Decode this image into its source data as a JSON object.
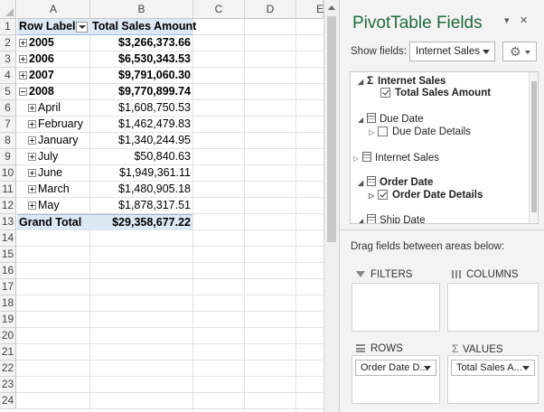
{
  "sheet": {
    "columns": [
      "A",
      "B",
      "C",
      "D",
      "E"
    ],
    "row_numbers": [
      "1",
      "2",
      "3",
      "4",
      "5",
      "6",
      "7",
      "8",
      "9",
      "10",
      "11",
      "12",
      "13",
      "14",
      "15",
      "16",
      "17",
      "18",
      "19",
      "20",
      "21",
      "22",
      "23",
      "24"
    ],
    "header": {
      "row_labels": "Row Labels",
      "total_sales_amount": "Total Sales Amount"
    },
    "years": [
      {
        "label": "2005",
        "value": "$3,266,373.66"
      },
      {
        "label": "2006",
        "value": "$6,530,343.53"
      },
      {
        "label": "2007",
        "value": "$9,791,060.30"
      },
      {
        "label": "2008",
        "value": "$9,770,899.74"
      }
    ],
    "months": [
      {
        "label": "April",
        "value": "$1,608,750.53"
      },
      {
        "label": "February",
        "value": "$1,462,479.83"
      },
      {
        "label": "January",
        "value": "$1,340,244.95"
      },
      {
        "label": "July",
        "value": "$50,840.63"
      },
      {
        "label": "June",
        "value": "$1,949,361.11"
      },
      {
        "label": "March",
        "value": "$1,480,905.18"
      },
      {
        "label": "May",
        "value": "$1,878,317.51"
      }
    ],
    "grand_total": {
      "label": "Grand Total",
      "value": "$29,358,677.22"
    }
  },
  "pane": {
    "title": "PivotTable Fields",
    "dropdown_glyph": "▾",
    "close_glyph": "✕",
    "show_fields_label": "Show fields:",
    "show_fields_value": "Internet Sales",
    "gear_glyph": "⚙",
    "field_list": {
      "internet_sales_measure_group": "Internet Sales",
      "total_sales_amount": "Total Sales Amount",
      "due_date": "Due Date",
      "due_date_details": "Due Date Details",
      "internet_sales_table": "Internet Sales",
      "order_date": "Order Date",
      "order_date_details": "Order Date Details",
      "ship_date": "Ship Date"
    },
    "drag_hint": "Drag fields between areas below:",
    "areas": {
      "filters": "FILTERS",
      "columns": "COLUMNS",
      "rows": "ROWS",
      "values": "VALUES",
      "rows_chip": "Order Date D...",
      "values_chip": "Total Sales A..."
    }
  }
}
